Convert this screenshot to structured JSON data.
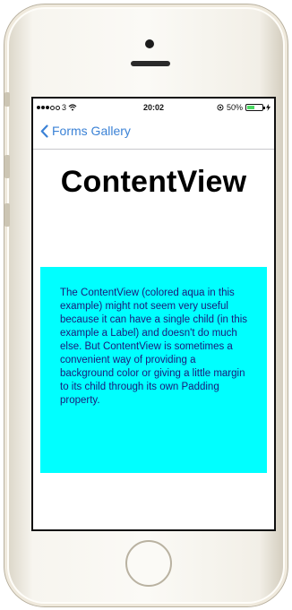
{
  "status_bar": {
    "carrier": "3",
    "time": "20:02",
    "battery_percent": "50%",
    "battery_level": 0.5
  },
  "nav": {
    "back_label": "Forms Gallery"
  },
  "page": {
    "title": "ContentView",
    "content_bg_color": "#00ffff",
    "label_text": "The ContentView (colored aqua in this example) might not seem very useful because it can have a single child (in this example a Label) and doesn't do much else. But ContentView is sometimes a convenient way of providing a background color or giving a little margin to its child through its own Padding property."
  },
  "colors": {
    "accent": "#3b82d6",
    "label_text": "#1a1a7a"
  }
}
